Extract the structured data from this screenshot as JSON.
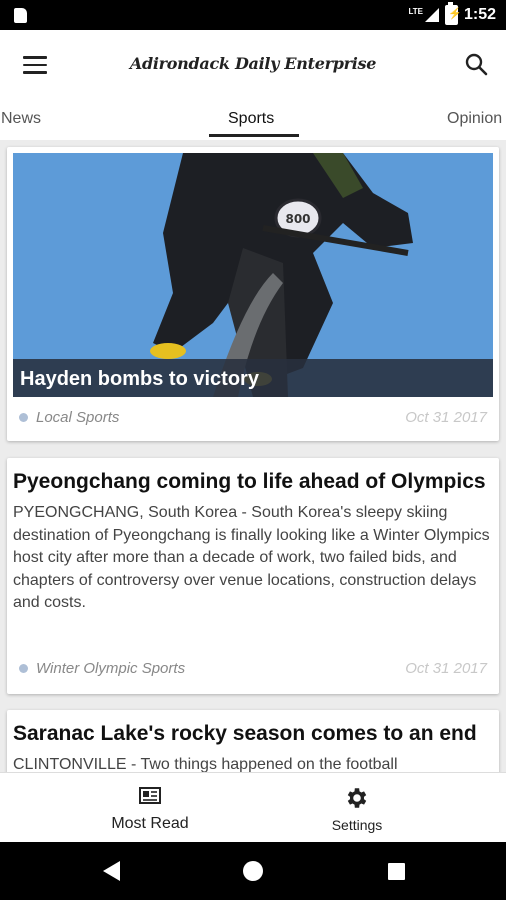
{
  "status_bar": {
    "time": "1:52",
    "network": "LTE"
  },
  "app_bar": {
    "masthead": "Adirondack Daily Enterprise"
  },
  "tabs": [
    {
      "label": "News"
    },
    {
      "label": "Sports"
    },
    {
      "label": "Opinion"
    }
  ],
  "active_tab": "Sports",
  "articles": [
    {
      "title": "Hayden bombs to victory",
      "category": "Local Sports",
      "date": "Oct 31 2017"
    },
    {
      "title": "Pyeongchang coming to life ahead of Olympics",
      "summary": "PYEONGCHANG, South Korea - South Korea's sleepy skiing destination of Pyeongchang is finally looking like a Winter Olympics host city after more than a decade of work, two failed bids, and chapters of controversy over venue locations, construction delays and costs.",
      "category": "Winter Olympic Sports",
      "date": "Oct 31 2017"
    },
    {
      "title": "Saranac Lake's rocky season comes to an end",
      "summary": "CLINTONVILLE - Two things happened on the football"
    }
  ],
  "bottom_nav": [
    {
      "label": "Most Read",
      "icon": "newspaper-icon"
    },
    {
      "label": "Settings",
      "icon": "gear-icon"
    }
  ],
  "system_nav": {
    "icons": [
      "back-icon",
      "home-icon",
      "recents-icon"
    ]
  },
  "colors": {
    "hero_sky": "#5d9bd8",
    "caption_bg": "#28303e",
    "category_dot": "#aebfd6"
  }
}
